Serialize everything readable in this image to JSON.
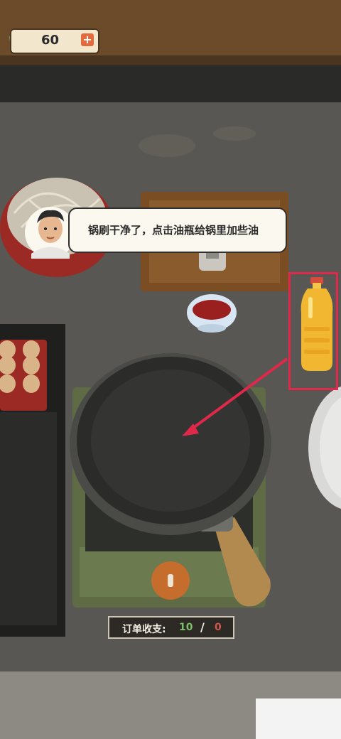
{
  "hud": {
    "money_value": "60",
    "plus_label": "+"
  },
  "tutorial": {
    "instruction": "锅刷干净了，点击油瓶给锅里加些油"
  },
  "ledger": {
    "label": "订单收支:",
    "income": "10",
    "separator": "/",
    "expense": "0"
  },
  "colors": {
    "highlight": "#e0284a",
    "income": "#7bbf6a",
    "expense": "#d2574a"
  }
}
